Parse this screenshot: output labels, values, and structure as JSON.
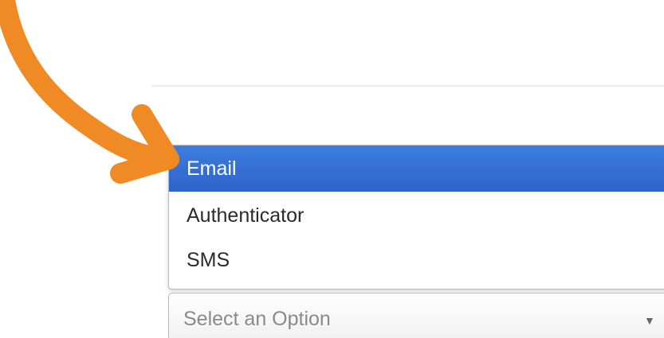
{
  "dropdown": {
    "options": [
      {
        "label": "Email",
        "selected": true
      },
      {
        "label": "Authenticator",
        "selected": false
      },
      {
        "label": "SMS",
        "selected": false
      }
    ],
    "selected_bg_color": "#3371d6",
    "placeholder": "Select an Option",
    "caret_glyph": "▼"
  },
  "annotation": {
    "arrow_color": "#ef8a24"
  }
}
